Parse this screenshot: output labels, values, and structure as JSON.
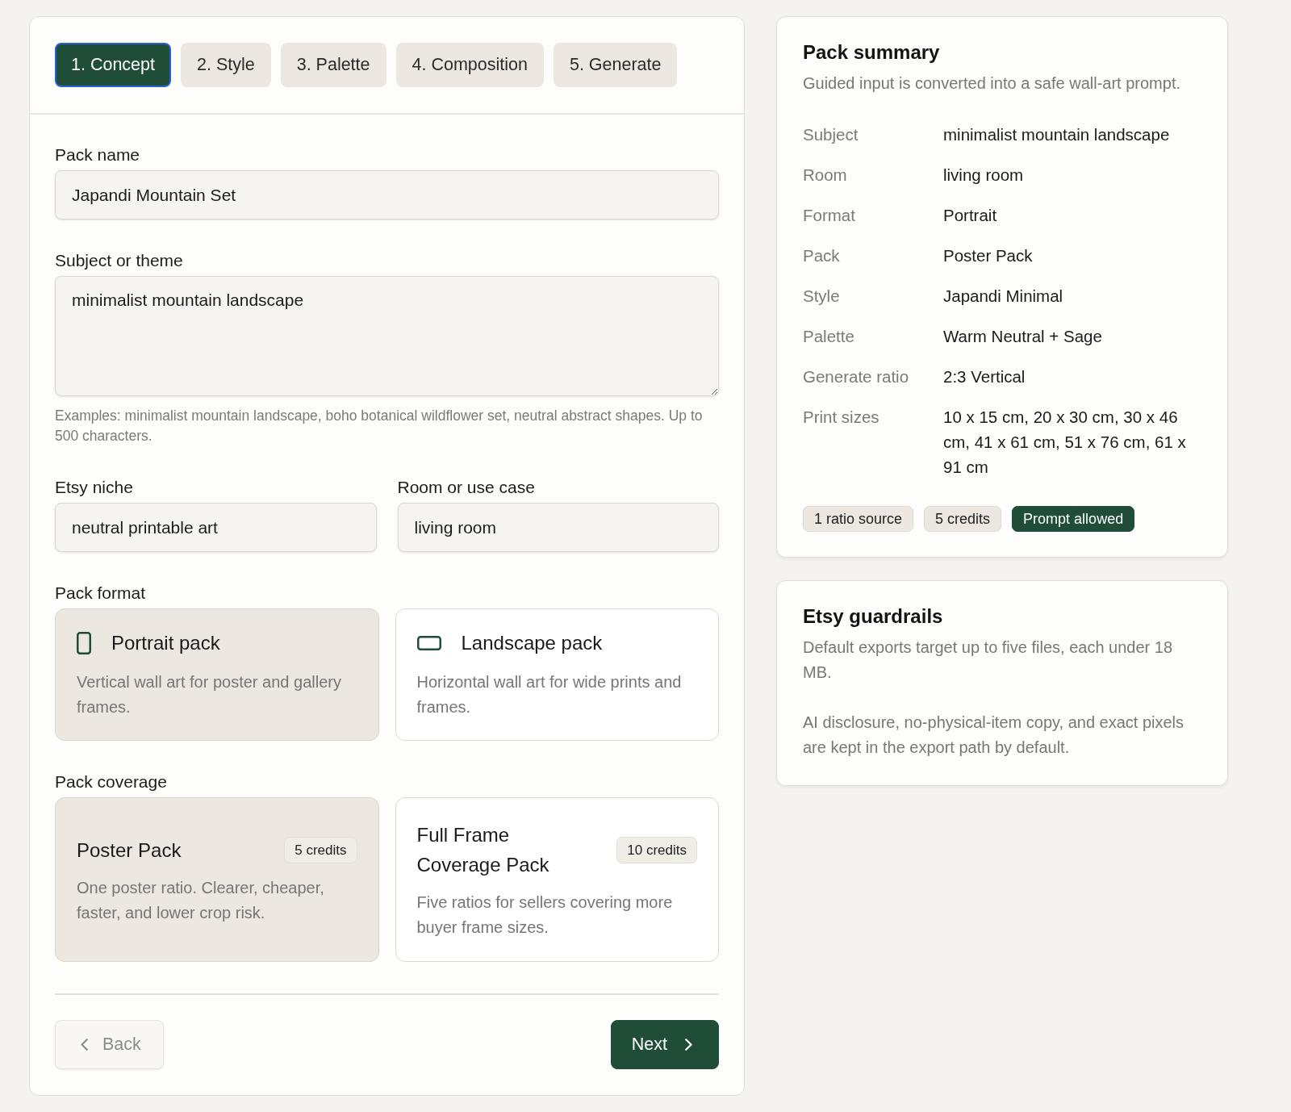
{
  "steps": [
    {
      "label": "1. Concept",
      "selected": true
    },
    {
      "label": "2. Style",
      "selected": false
    },
    {
      "label": "3. Palette",
      "selected": false
    },
    {
      "label": "4. Composition",
      "selected": false
    },
    {
      "label": "5. Generate",
      "selected": false
    }
  ],
  "form": {
    "pack_name": {
      "label": "Pack name",
      "value": "Japandi Mountain Set"
    },
    "subject": {
      "label": "Subject or theme",
      "value": "minimalist mountain landscape",
      "hint": "Examples: minimalist mountain landscape, boho botanical wildflower set, neutral abstract shapes. Up to 500 characters."
    },
    "etsy_niche": {
      "label": "Etsy niche",
      "value": "neutral printable art"
    },
    "room": {
      "label": "Room or use case",
      "value": "living room"
    },
    "pack_format": {
      "label": "Pack format",
      "options": [
        {
          "kind": "portrait",
          "title": "Portrait pack",
          "description": "Vertical wall art for poster and gallery frames.",
          "selected": true
        },
        {
          "kind": "landscape",
          "title": "Landscape pack",
          "description": "Horizontal wall art for wide prints and frames.",
          "selected": false
        }
      ]
    },
    "pack_coverage": {
      "label": "Pack coverage",
      "options": [
        {
          "title": "Poster Pack",
          "badge": "5 credits",
          "description": "One poster ratio. Clearer, cheaper, faster, and lower crop risk.",
          "selected": true
        },
        {
          "title": "Full Frame Coverage Pack",
          "badge": "10 credits",
          "description": "Five ratios for sellers covering more buyer frame sizes.",
          "selected": false
        }
      ]
    }
  },
  "actions": {
    "back": {
      "label": "Back",
      "disabled": true
    },
    "next": {
      "label": "Next"
    }
  },
  "summary": {
    "title": "Pack summary",
    "subtitle": "Guided input is converted into a safe wall-art prompt.",
    "rows": [
      {
        "label": "Subject",
        "value": "minimalist mountain landscape"
      },
      {
        "label": "Room",
        "value": "living room"
      },
      {
        "label": "Format",
        "value": "Portrait"
      },
      {
        "label": "Pack",
        "value": "Poster Pack"
      },
      {
        "label": "Style",
        "value": "Japandi Minimal"
      },
      {
        "label": "Palette",
        "value": "Warm Neutral + Sage"
      },
      {
        "label": "Generate ratio",
        "value": "2:3 Vertical"
      },
      {
        "label": "Print sizes",
        "value": "10 x 15 cm, 20 x 30 cm, 30 x 46 cm, 41 x 61 cm, 51 x 76 cm, 61 x 91 cm"
      }
    ],
    "badges": [
      {
        "label": "1 ratio source",
        "kind": "neutral"
      },
      {
        "label": "5 credits",
        "kind": "neutral"
      },
      {
        "label": "Prompt allowed",
        "kind": "success"
      }
    ]
  },
  "guardrails": {
    "title": "Etsy guardrails",
    "paragraphs": [
      "Default exports target up to five files, each under 18 MB.",
      "AI disclosure, no-physical-item copy, and exact pixels are kept in the export path by default."
    ]
  }
}
